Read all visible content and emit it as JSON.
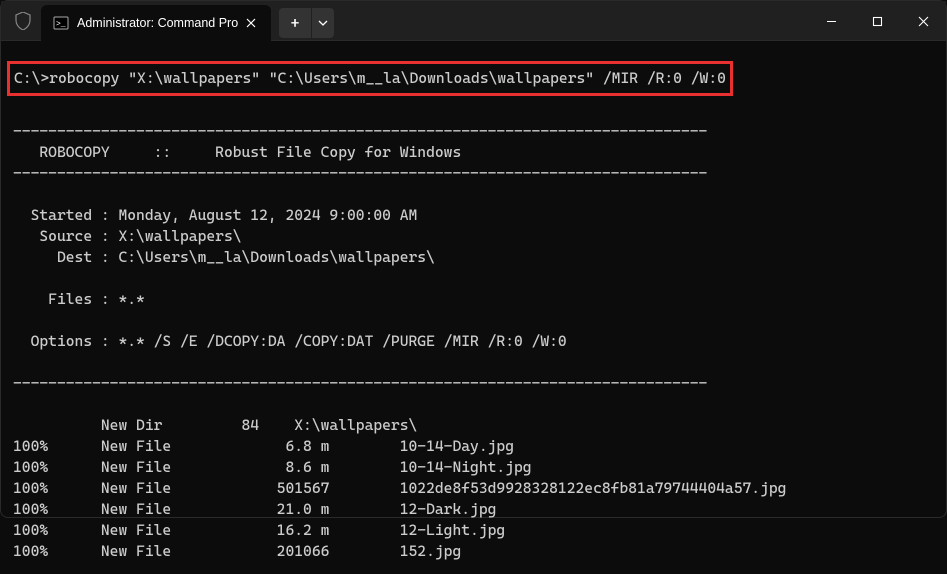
{
  "window": {
    "tab_title": "Administrator: Command Pro",
    "new_tab": "+",
    "close": "×"
  },
  "terminal": {
    "prompt": "C:\\>robocopy \"X:\\wallpapers\" \"C:\\Users\\m__la\\Downloads\\wallpapers\" /MIR /R:0 /W:0",
    "divider": "-------------------------------------------------------------------------------",
    "header": "   ROBOCOPY     ::     Robust File Copy for Windows",
    "info": {
      "started": "  Started : Monday, August 12, 2024 9:00:00 AM",
      "source": "   Source : X:\\wallpapers\\",
      "dest": "     Dest : C:\\Users\\m__la\\Downloads\\wallpapers\\",
      "files": "    Files : *.*",
      "options": "  Options : *.* /S /E /DCOPY:DA /COPY:DAT /PURGE /MIR /R:0 /W:0"
    },
    "newdir": "          New Dir         84    X:\\wallpapers\\",
    "files": [
      {
        "pct": "100%",
        "type": "New File",
        "size": "6.8 m",
        "name": "10-14-Day.jpg"
      },
      {
        "pct": "100%",
        "type": "New File",
        "size": "8.6 m",
        "name": "10-14-Night.jpg"
      },
      {
        "pct": "100%",
        "type": "New File",
        "size": "501567",
        "name": "1022de8f53d9928328122ec8fb81a79744404a57.jpg"
      },
      {
        "pct": "100%",
        "type": "New File",
        "size": "21.0 m",
        "name": "12-Dark.jpg"
      },
      {
        "pct": "100%",
        "type": "New File",
        "size": "16.2 m",
        "name": "12-Light.jpg"
      },
      {
        "pct": "100%",
        "type": "New File",
        "size": "201066",
        "name": "152.jpg"
      }
    ]
  }
}
